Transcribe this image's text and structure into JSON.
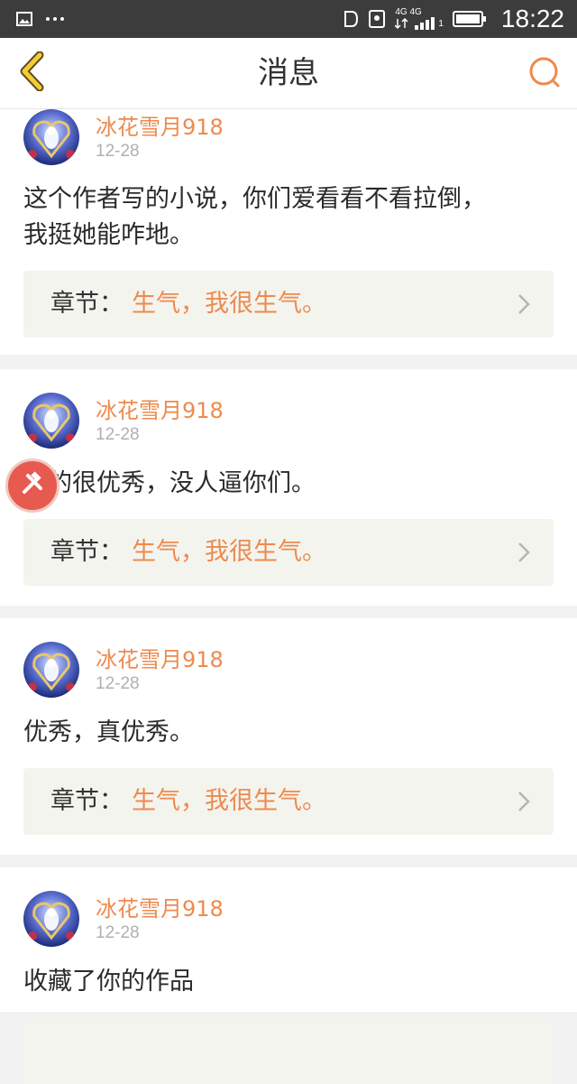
{
  "status_bar": {
    "time": "18:22",
    "network_top": "4G 4G",
    "sim_index": "1"
  },
  "header": {
    "title": "消息"
  },
  "messages": [
    {
      "username": "冰花雪月918",
      "date": "12-28",
      "content_line1": "这个作者写的小说，你们爱看看不看拉倒，",
      "content_line2": "我挺她能咋地。",
      "chapter_label": "章节：",
      "chapter_title": "生气，我很生气。"
    },
    {
      "username": "冰花雪月918",
      "date": "12-28",
      "content_line1": "真的很优秀，没人逼你们。",
      "chapter_label": "章节：",
      "chapter_title": "生气，我很生气。"
    },
    {
      "username": "冰花雪月918",
      "date": "12-28",
      "content_line1": "优秀，真优秀。",
      "chapter_label": "章节：",
      "chapter_title": "生气，我很生气。"
    },
    {
      "username": "冰花雪月918",
      "date": "12-28",
      "content_line1": "收藏了你的作品"
    }
  ],
  "colors": {
    "accent": "#ee8a4e",
    "status_bar_bg": "#3c3c3c",
    "chapter_bg": "#f4f4ee",
    "floating_button": "#e75a50"
  },
  "icons": {
    "back": "chevron-left-icon",
    "search": "search-icon",
    "chapter_arrow": "chevron-right-icon",
    "floating": "floating-assist-icon"
  }
}
